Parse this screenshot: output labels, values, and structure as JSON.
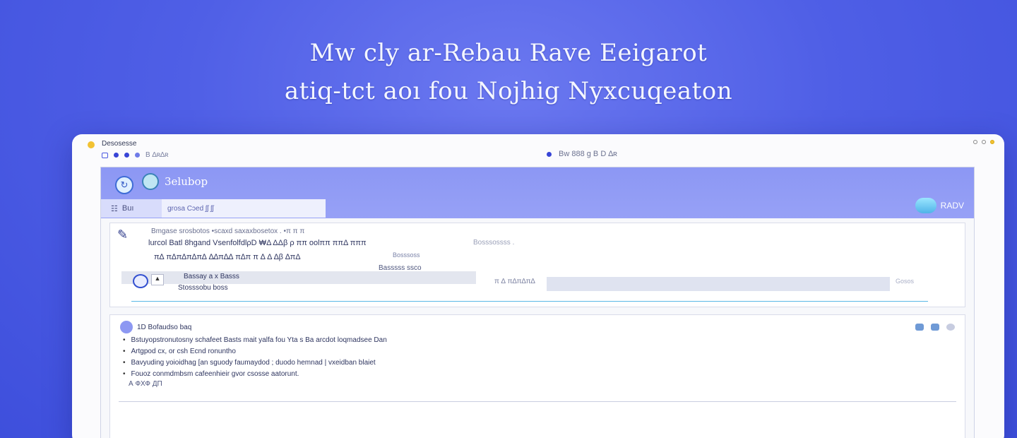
{
  "hero": {
    "line1": "Mw cly ar-Rebau Rave Eeigarot",
    "line2": "atiq-tct aoı fou Nojhig Nyxcuqeaton"
  },
  "window": {
    "app_name": "Desosesse",
    "titlebar_left": "B ∆ʀ∆ʀ",
    "titlebar_center": "Bw   888 g B D ∆ʀ"
  },
  "header": {
    "title": "3elubop",
    "filter_label": "Buı",
    "search_value": "grosa Cɔed ʃʃ ʃʃ",
    "status_label": "RADV"
  },
  "card1": {
    "line1": "Bmgase srosbotos   •scaxd saxaxbosetox  .   •π π π",
    "line2": "lurcol Batl 8hgand VsenfolfdlρD ₩Δ ΔΔβ ρ ππ oolππ ππΔ πππ",
    "line2b": "Bosssossss .",
    "line3": "π∆ π∆π∆π∆π∆ ∆∆π∆∆ π∆π π ∆ Δ ∆β ∆πΔ",
    "line3b": "Bosssoss",
    "line4": "Basssss ssco",
    "row_label": "Bassay a x Basss",
    "row_sub": "Stosssobu boss",
    "field_label": "π ∆ π∆π∆π∆",
    "field_hint": "Gosos"
  },
  "card2": {
    "title": "1D Bofaudso baq",
    "items": [
      "Bstuyopstronutosny schafeet Basts mait yalfa fou Yta s Ba arcdot loqmadsee Dan",
      "Artgpod cx, or csh Ecnd ronuntho",
      "Bavyuding yoioidhag [an sguody faumaydod ; duodo hemnad | vxeidban blaiet",
      "Fouoz  conmdmbsm cafeenhieir gvor csosse aatorunt."
    ],
    "meta": "А ФХФ ДП"
  }
}
